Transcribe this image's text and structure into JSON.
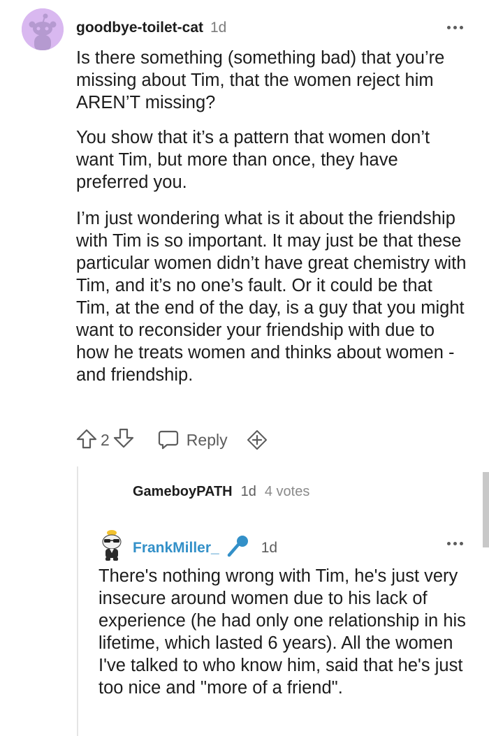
{
  "comment": {
    "username": "goodbye-toilet-cat",
    "age": "1d",
    "avatar_icon": "snoo-avatar-icon",
    "paragraphs": [
      "Is there something (something bad) that you’re missing about Tim, that the women reject him AREN’T missing?",
      "You show that it’s a pattern that women don’t want Tim, but more than once, they have preferred you.",
      "I’m just wondering what is it about the friendship with Tim is so important. It may just be that these particular women didn’t have great chemistry with Tim, and it’s no one’s fault. Or it could be that Tim, at the end of the day, is a guy that you might want to reconsider your friendship with due to how he treats women and thinks about women - and friendship."
    ],
    "vote_count": "2",
    "reply_label": "Reply"
  },
  "collapsed_reply": {
    "username": "GameboyPATH",
    "age": "1d",
    "votes": "4 votes"
  },
  "nested_reply": {
    "username": "FrankMiller_",
    "badge_icon": "microphone-icon",
    "age": "1d",
    "text": "There's nothing wrong with Tim, he's just very insecure around women due to his lack of experience (he had only one relationship in his lifetime, which lasted 6 years). All the women I've talked to who know him, said that he's just too nice and \"more of a friend\"."
  },
  "colors": {
    "username_link": "#3390c8",
    "avatar_bg": "#d9b8f0",
    "text": "#1c1c1c",
    "muted": "#7c7c7c"
  }
}
